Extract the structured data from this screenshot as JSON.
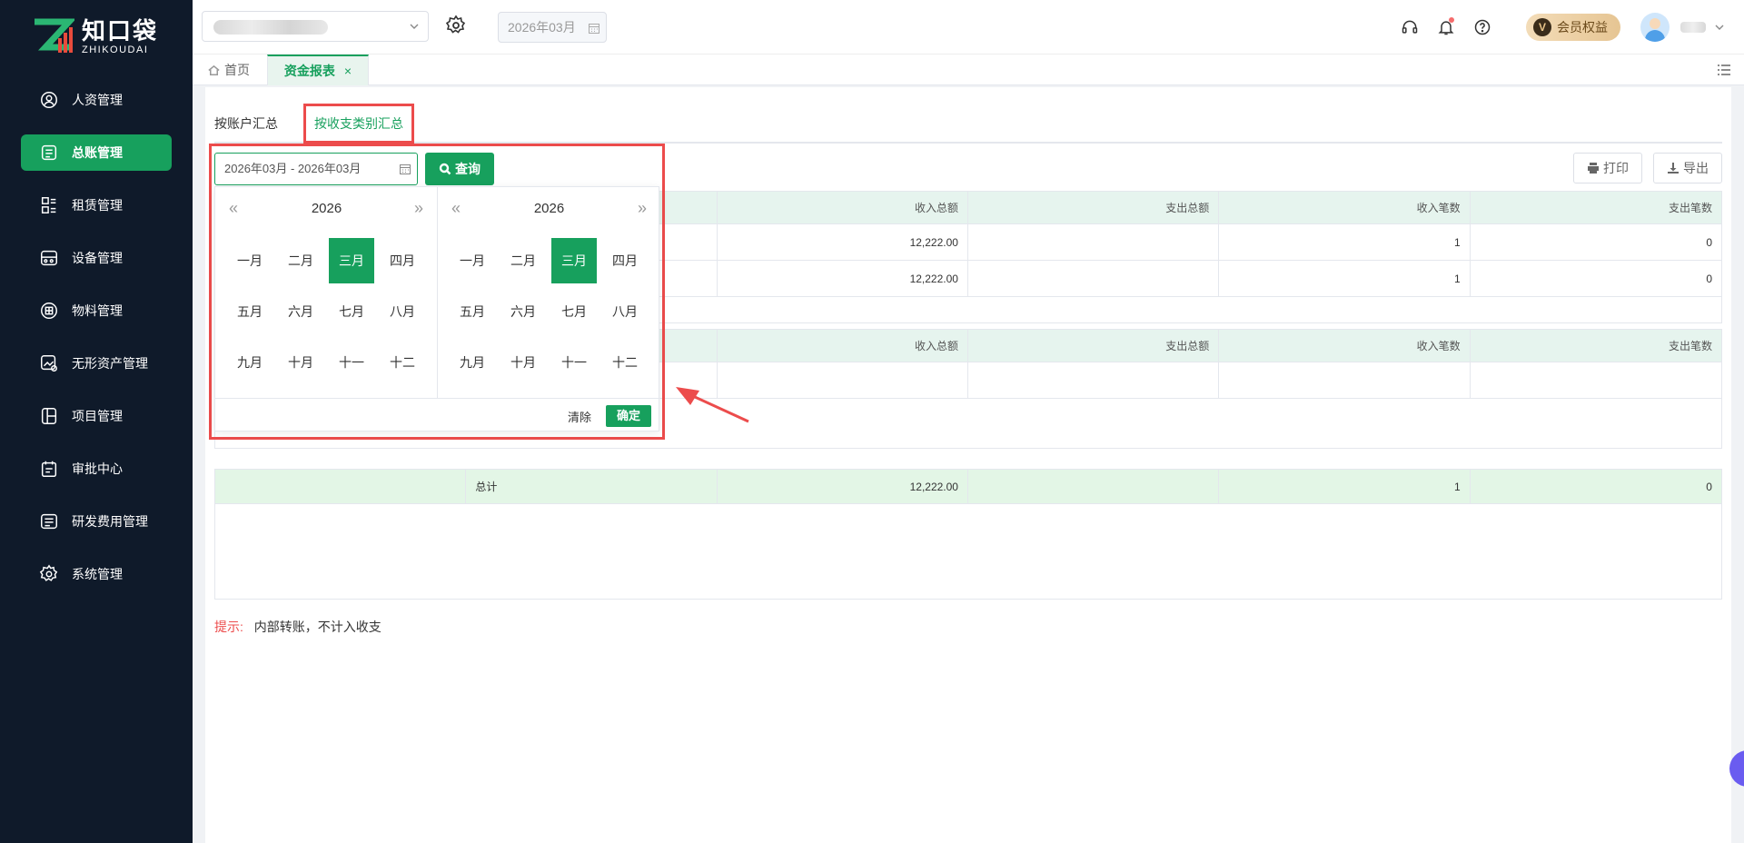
{
  "brand": {
    "name_cn": "知口袋",
    "name_en": "ZHIKOUDAI",
    "accent": "#17a05d"
  },
  "sidebar": {
    "items": [
      {
        "label": "人资管理",
        "icon": "user-circle-icon",
        "active": false
      },
      {
        "label": "总账管理",
        "icon": "ledger-icon",
        "active": true
      },
      {
        "label": "租赁管理",
        "icon": "lease-icon",
        "active": false
      },
      {
        "label": "设备管理",
        "icon": "device-icon",
        "active": false
      },
      {
        "label": "物料管理",
        "icon": "material-icon",
        "active": false
      },
      {
        "label": "无形资产管理",
        "icon": "intangible-asset-icon",
        "active": false
      },
      {
        "label": "项目管理",
        "icon": "project-icon",
        "active": false
      },
      {
        "label": "审批中心",
        "icon": "approval-icon",
        "active": false
      },
      {
        "label": "研发费用管理",
        "icon": "rd-expense-icon",
        "active": false
      },
      {
        "label": "系统管理",
        "icon": "gear-icon",
        "active": false
      }
    ]
  },
  "header": {
    "period": "2026年03月",
    "vip_badge": "会员权益",
    "vip_letter": "V"
  },
  "tabs": {
    "home": "首页",
    "report": "资金报表",
    "close": "×"
  },
  "subtabs": {
    "by_account": "按账户汇总",
    "by_category": "按收支类别汇总"
  },
  "toolbar": {
    "range_value": "2026年03月 - 2026年03月",
    "query": "查询",
    "print": "打印",
    "export": "导出"
  },
  "table_headers": [
    "收入总额",
    "支出总额",
    "收入笔数",
    "支出笔数"
  ],
  "table1_rows": [
    [
      "12,222.00",
      "",
      "1",
      "0"
    ],
    [
      "12,222.00",
      "",
      "1",
      "0"
    ]
  ],
  "table3": {
    "label": "总计",
    "values": [
      "12,222.00",
      "",
      "1",
      "0"
    ]
  },
  "tip": {
    "label": "提示:",
    "text": "内部转账，不计入收支"
  },
  "picker": {
    "left_year": "2026",
    "right_year": "2026",
    "prev": "«",
    "next": "»",
    "months": [
      "一月",
      "二月",
      "三月",
      "四月",
      "五月",
      "六月",
      "七月",
      "八月",
      "九月",
      "十月",
      "十一",
      "十二"
    ],
    "selected_index": 2,
    "clear": "清除",
    "confirm": "确定"
  }
}
